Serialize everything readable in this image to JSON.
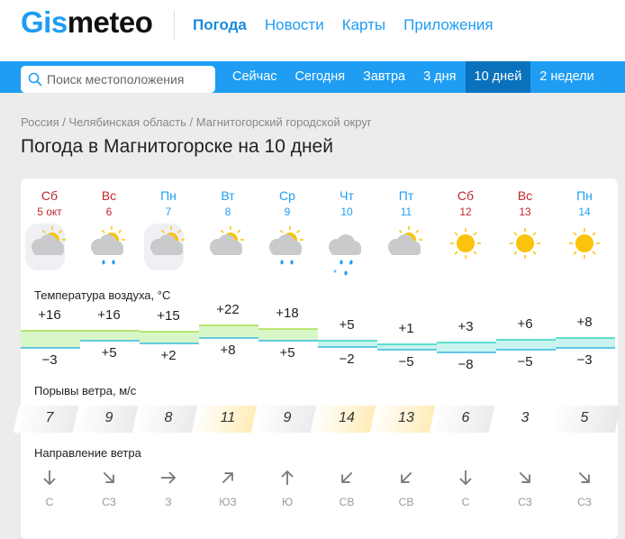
{
  "header": {
    "logo": "Gismeteo",
    "logo_a": "Gis",
    "logo_b": "meteo",
    "nav": [
      "Погода",
      "Новости",
      "Карты",
      "Приложения"
    ]
  },
  "nav": {
    "search_placeholder": "Поиск местоположения",
    "tabs": [
      "Сейчас",
      "Сегодня",
      "Завтра",
      "3 дня",
      "10 дней",
      "2 недели"
    ],
    "active_tab": "10 дней"
  },
  "breadcrumb": "Россия / Челябинская область / Магнитогорский городской округ",
  "page_title": "Погода в Магнитогорске на 10 дней",
  "forecast": {
    "days": [
      {
        "dow": "Сб",
        "date": "5 окт",
        "weekend": true,
        "icon": "partly-cloudy-haze"
      },
      {
        "dow": "Вс",
        "date": "6",
        "weekend": true,
        "icon": "partly-cloudy-rain"
      },
      {
        "dow": "Пн",
        "date": "7",
        "weekend": false,
        "icon": "partly-cloudy-haze"
      },
      {
        "dow": "Вт",
        "date": "8",
        "weekend": false,
        "icon": "partly-cloudy"
      },
      {
        "dow": "Ср",
        "date": "9",
        "weekend": false,
        "icon": "cloudy-sun-rain"
      },
      {
        "dow": "Чт",
        "date": "10",
        "weekend": false,
        "icon": "cloudy-rain-snow"
      },
      {
        "dow": "Пт",
        "date": "11",
        "weekend": false,
        "icon": "cloudy-sun"
      },
      {
        "dow": "Сб",
        "date": "12",
        "weekend": true,
        "icon": "sunny"
      },
      {
        "dow": "Вс",
        "date": "13",
        "weekend": true,
        "icon": "sunny"
      },
      {
        "dow": "Пн",
        "date": "14",
        "weekend": false,
        "icon": "sunny"
      }
    ],
    "temp_label": "Температура воздуха, °C",
    "temp_max": [
      "+16",
      "+16",
      "+15",
      "+22",
      "+18",
      "+5",
      "+1",
      "+3",
      "+6",
      "+8"
    ],
    "temp_min": [
      "−3",
      "+5",
      "+2",
      "+8",
      "+5",
      "−2",
      "−5",
      "−8",
      "−5",
      "−3"
    ],
    "gust_label": "Порывы ветра, м/с",
    "gusts": [
      "7",
      "9",
      "8",
      "11",
      "9",
      "14",
      "13",
      "6",
      "3",
      "5"
    ],
    "dir_label": "Направление ветра",
    "directions": [
      "С",
      "СЗ",
      "З",
      "ЮЗ",
      "Ю",
      "СВ",
      "СВ",
      "С",
      "СЗ",
      "СЗ"
    ],
    "dir_icons": [
      "arrow-down",
      "arrow-down-right",
      "arrow-right",
      "arrow-up-right",
      "arrow-up",
      "arrow-down-left",
      "arrow-down-left",
      "arrow-down",
      "arrow-down-right",
      "arrow-down-right"
    ]
  },
  "colors": {
    "brand": "#1e9df3",
    "weekend": "#c0272d",
    "active_tab": "#0a72bd",
    "gust_strong": "#ffeab0",
    "gust_normal": "#e8e9eb"
  }
}
